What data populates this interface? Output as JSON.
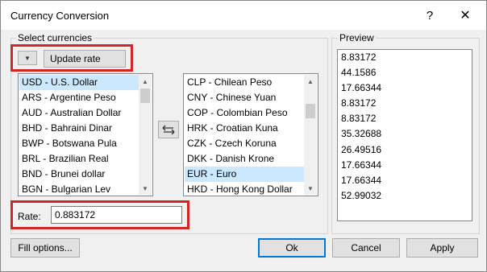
{
  "window": {
    "title": "Currency Conversion",
    "help_symbol": "?",
    "close_symbol": "✕"
  },
  "select_currencies": {
    "label": "Select currencies",
    "update_rate_label": "Update rate",
    "source_list": [
      "USD - U.S. Dollar",
      "ARS - Argentine Peso",
      "AUD - Australian Dollar",
      "BHD - Bahraini Dinar",
      "BWP - Botswana Pula",
      "BRL - Brazilian Real",
      "BND - Brunei dollar",
      "BGN - Bulgarian Lev"
    ],
    "source_selected_index": 0,
    "target_list": [
      "CLP - Chilean Peso",
      "CNY - Chinese Yuan",
      "COP - Colombian Peso",
      "HRK - Croatian Kuna",
      "CZK - Czech Koruna",
      "DKK - Danish Krone",
      "EUR - Euro",
      "HKD - Hong Kong Dollar"
    ],
    "target_selected_index": 6,
    "rate_label": "Rate:",
    "rate_value": "0.883172"
  },
  "preview": {
    "label": "Preview",
    "values": [
      "8.83172",
      "44.1586",
      "17.66344",
      "8.83172",
      "8.83172",
      "35.32688",
      "26.49516",
      "17.66344",
      "17.66344",
      "52.99032"
    ]
  },
  "buttons": {
    "fill_options": "Fill options...",
    "ok": "Ok",
    "cancel": "Cancel",
    "apply": "Apply"
  },
  "colors": {
    "highlight_box": "#d42525",
    "selection": "#cce8ff",
    "default_button_border": "#0078d7"
  },
  "icons": {
    "dropdown": "triangle-down-icon",
    "swap": "swap-arrows-icon"
  }
}
